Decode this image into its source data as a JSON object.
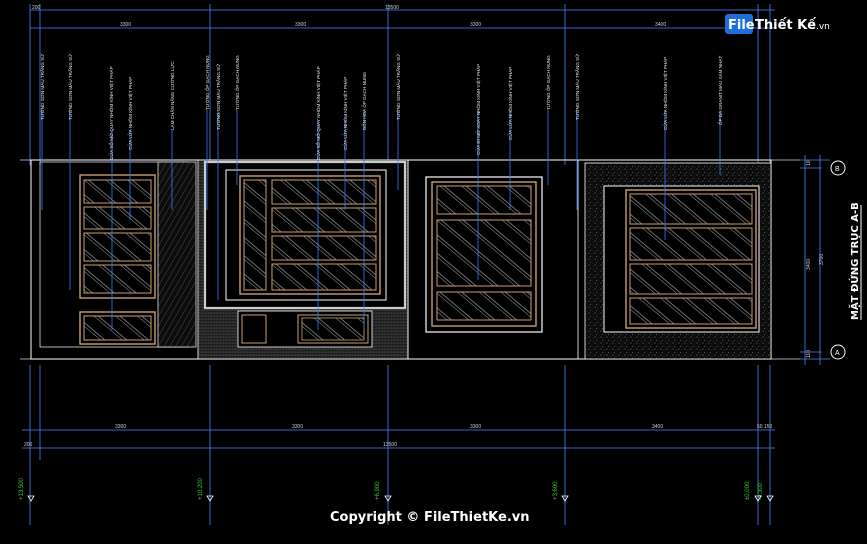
{
  "drawing_title": "MẶT ĐỨNG TRỤC A-B",
  "axis_labels": [
    "B",
    "A"
  ],
  "top_dimensions": {
    "segments": [
      "200",
      "3300",
      "3300",
      "3300",
      "3400"
    ],
    "total": "13500"
  },
  "bottom_dimensions": {
    "segments": [
      "200",
      "3300",
      "3300",
      "3300",
      "3400",
      "50",
      "150"
    ],
    "total": "13500"
  },
  "right_dimensions": [
    "3400",
    "3700",
    "10",
    "110"
  ],
  "level_markers": [
    "+13.500",
    "+10.200",
    "+6.900",
    "+3.600",
    "±0.000",
    "-0.300"
  ],
  "material_labels": [
    "TƯỜNG SƠN MÀU TRẮNG SỮ",
    "TƯỜNG SƠN MÀU TRẮNG SỮ",
    "CỬA SỔ MỞ QUAY NHÔM KÍNH VIỆT PHÁP",
    "CỬA LỬA NHÔM KÍNH VIỆT PHÁP",
    "LAM CHẮN NẮNG CƯỜNG LỰC",
    "TƯỜNG ỐP GẠCH NUNG",
    "TƯỜNG SƠN MÀU TRẮNG SỮ",
    "TƯỜNG ỐP GẠCH NUNG",
    "CỬA SỔ MỞ QUAY NHÔM KÍNH VIỆT PHÁP",
    "CỬA LỬA NHÔM KÍNH VIỆT PHÁP",
    "BỒN HOA ỐP GẠCH NUNG",
    "TƯỜNG SƠN MÀU TRẮNG SỮ",
    "CỬA ĐI MỞ XOAY NHÔM KÍNH VIỆT PHÁP",
    "CỬA LỬA NHÔM KÍNH VIỆT PHÁP",
    "TƯỜNG ỐP GẠCH NUNG",
    "TƯỜNG SƠN MÀU TRẮNG SỮ",
    "CỬA LỬA NHÔM KÍNH VIỆT PHÁP",
    "ỐP ĐÁ GRANIT MÀU XÁM NHẠT"
  ],
  "watermark": {
    "logo_file": "File",
    "logo_rest": "Thiết Kế",
    "logo_suffix": ".vn",
    "copyright": "Copyright © FileThietKe.vn"
  },
  "colors": {
    "background": "#000000",
    "dimension_line": "#4a86ff",
    "leader_line": "#3a7bff",
    "window_frame": "#c8a070",
    "wall_outline": "#ffffff",
    "level_text": "#33cc33",
    "label_text": "#e6e6e6"
  }
}
